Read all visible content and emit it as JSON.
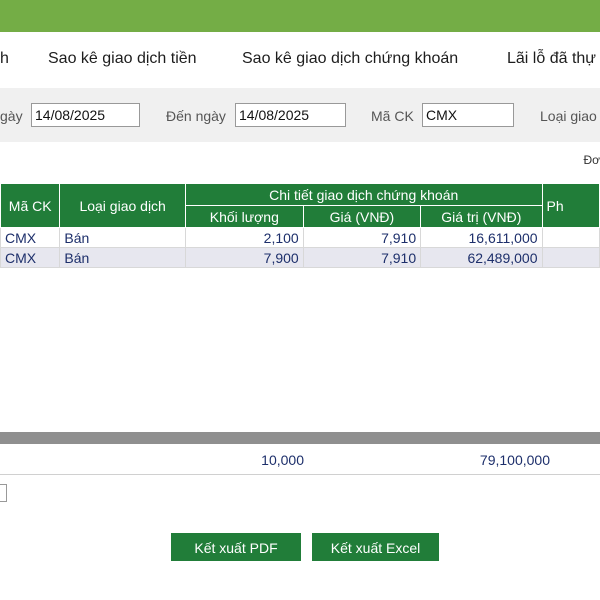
{
  "tabs": [
    {
      "label": "h"
    },
    {
      "label": "Sao kê giao dịch tiền"
    },
    {
      "label": "Sao kê giao dịch chứng khoán"
    },
    {
      "label": "Lãi lỗ đã thự"
    }
  ],
  "filters": {
    "from_label": "gày",
    "from_value": "14/08/2025",
    "to_label": "Đến ngày",
    "to_value": "14/08/2025",
    "symbol_label": "Mã CK",
    "symbol_value": "CMX",
    "type_label": "Loại giao"
  },
  "unit_note": "Đơ",
  "table": {
    "headers": {
      "symbol": "Mã CK",
      "type": "Loại giao dịch",
      "detail": "Chi tiết giao dịch chứng khoán",
      "volume": "Khối lượng",
      "price": "Giá (VNĐ)",
      "value": "Giá trị (VNĐ)",
      "fee": "Ph"
    },
    "rows": [
      {
        "symbol": "CMX",
        "type": "Bán",
        "volume": "2,100",
        "price": "7,910",
        "value": "16,611,000",
        "fee": ""
      },
      {
        "symbol": "CMX",
        "type": "Bán",
        "volume": "7,900",
        "price": "7,910",
        "value": "62,489,000",
        "fee": ""
      }
    ],
    "totals": {
      "volume": "10,000",
      "value": "79,100,000"
    }
  },
  "buttons": {
    "export_pdf": "Kết xuất PDF",
    "export_excel": "Kết xuất Excel"
  },
  "colors": {
    "top_bar": "#74ad46",
    "header_green": "#217d39",
    "row_text": "#1d2f6b"
  }
}
